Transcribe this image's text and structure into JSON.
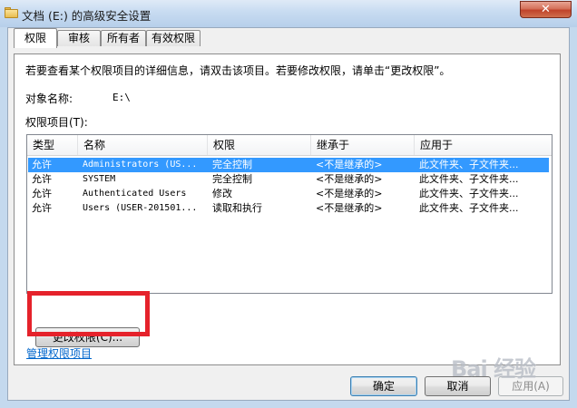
{
  "window": {
    "title": "文档 (E:) 的高级安全设置",
    "close_label": "✕"
  },
  "tabs": [
    {
      "label": "权限",
      "active": true
    },
    {
      "label": "审核",
      "active": false
    },
    {
      "label": "所有者",
      "active": false
    },
    {
      "label": "有效权限",
      "active": false
    }
  ],
  "panel": {
    "intro": "若要查看某个权限项目的详细信息，请双击该项目。若要修改权限，请单击“更改权限”。",
    "object_label": "对象名称:",
    "object_value": "E:\\",
    "list_label": "权限项目(T):"
  },
  "list": {
    "columns": [
      "类型",
      "名称",
      "权限",
      "继承于",
      "应用于"
    ],
    "rows": [
      {
        "type": "允许",
        "name": "Administrators (US...",
        "permission": "完全控制",
        "inherited": "<不是继承的>",
        "applies": "此文件夹、子文件夹..."
      },
      {
        "type": "允许",
        "name": "SYSTEM",
        "permission": "完全控制",
        "inherited": "<不是继承的>",
        "applies": "此文件夹、子文件夹..."
      },
      {
        "type": "允许",
        "name": "Authenticated Users",
        "permission": "修改",
        "inherited": "<不是继承的>",
        "applies": "此文件夹、子文件夹..."
      },
      {
        "type": "允许",
        "name": "Users (USER-201501...",
        "permission": "读取和执行",
        "inherited": "<不是继承的>",
        "applies": "此文件夹、子文件夹..."
      }
    ]
  },
  "buttons": {
    "change_permissions": "更改权限(C)...",
    "ok": "确定",
    "cancel": "取消",
    "apply": "应用(A)"
  },
  "link": {
    "manage": "管理权限项目"
  },
  "watermark": "Bai 经验",
  "colors": {
    "selection": "#3399ff",
    "highlight": "#e5222b",
    "link": "#0066cc"
  }
}
